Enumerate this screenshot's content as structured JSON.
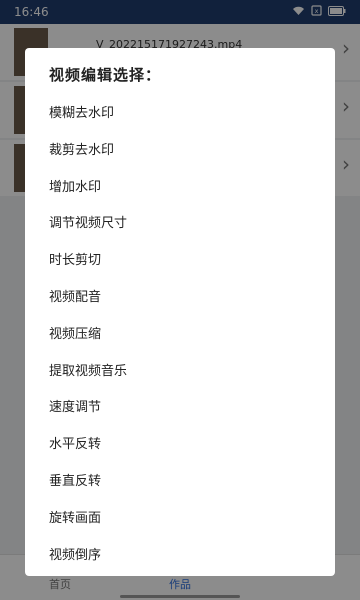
{
  "status_bar": {
    "time": "16:46",
    "battery": "▭"
  },
  "background": {
    "file_name": "V_202215171927243.mp4",
    "tabs": [
      {
        "label": "首页"
      },
      {
        "label": "作品"
      },
      {
        "label": ""
      }
    ]
  },
  "dialog": {
    "title": "视频编辑选择：",
    "items": [
      "模糊去水印",
      "裁剪去水印",
      "增加水印",
      "调节视频尺寸",
      "时长剪切",
      "视频配音",
      "视频压缩",
      "提取视频音乐",
      "速度调节",
      "水平反转",
      "垂直反转",
      "旋转画面",
      "视频倒序"
    ]
  },
  "colors": {
    "status_bar": "#1f3d6e",
    "accent": "#2f6fde",
    "scrim": "rgba(0,0,0,0.45)"
  },
  "icons": [
    "wifi-icon",
    "sim-icon",
    "battery-icon",
    "chevron-right-icon"
  ]
}
